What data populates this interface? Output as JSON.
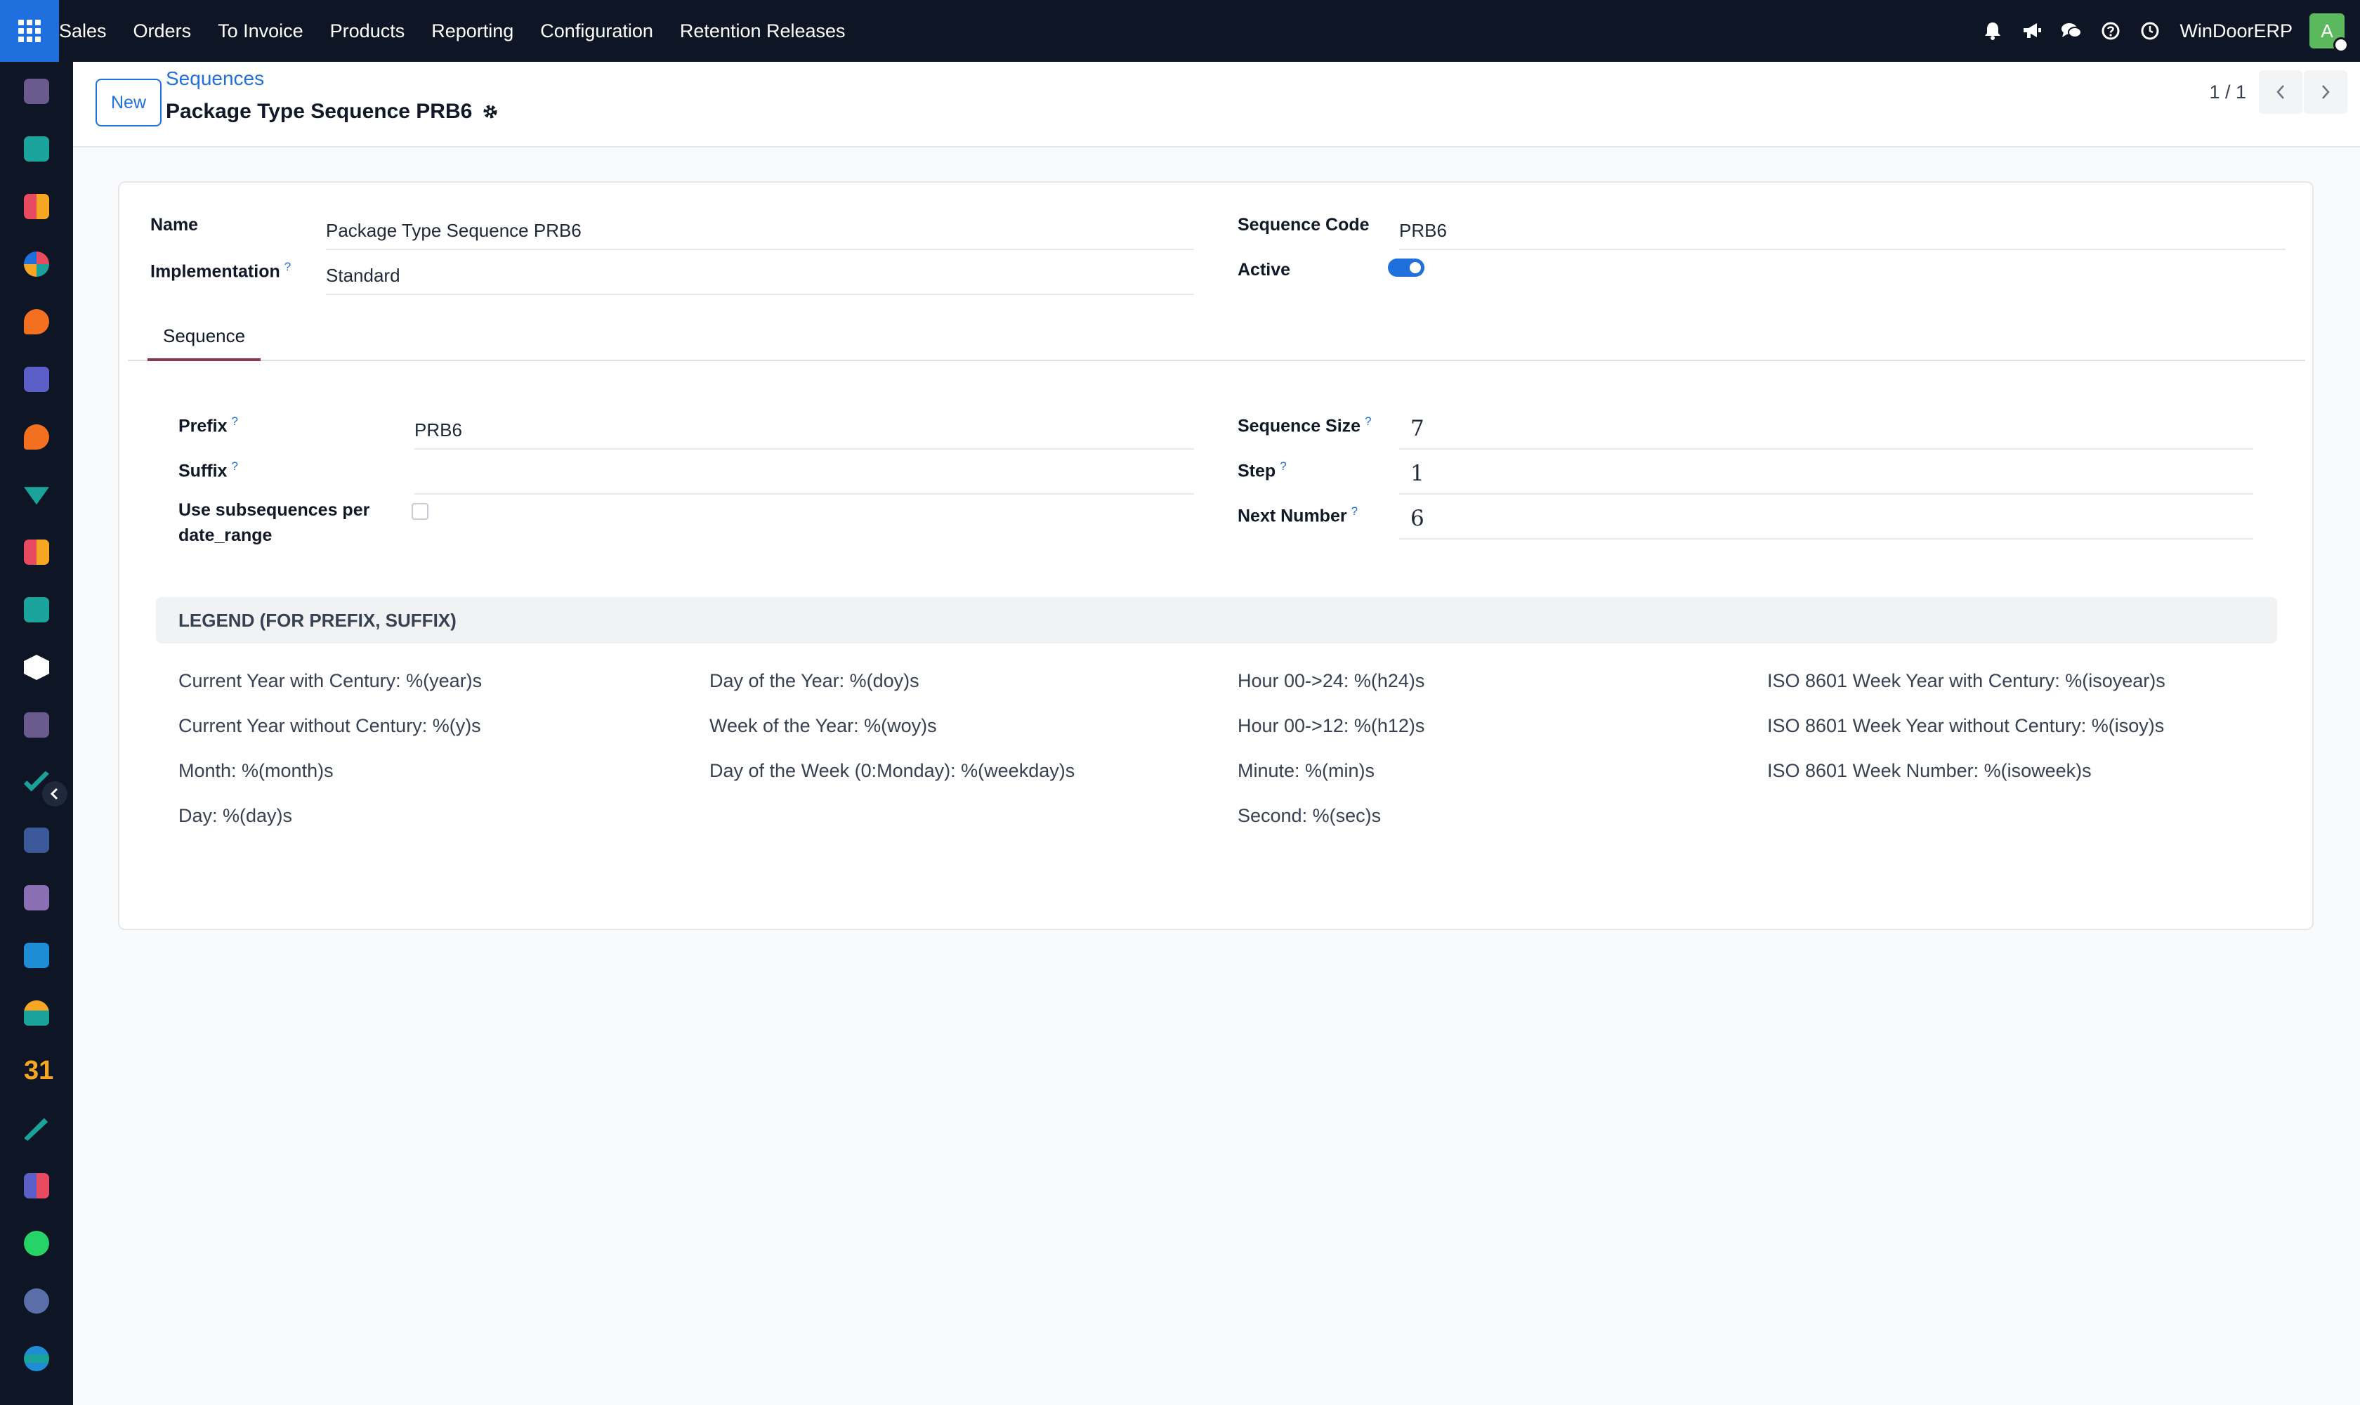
{
  "topbar": {
    "menu": [
      "Sales",
      "Orders",
      "To Invoice",
      "Products",
      "Reporting",
      "Configuration",
      "Retention Releases"
    ],
    "company": "WinDoorERP",
    "avatar_initial": "A",
    "icons": [
      "bell-icon",
      "megaphone-icon",
      "chat-icon",
      "help-icon",
      "clock-icon"
    ]
  },
  "sidebar": {
    "apps": [
      "discuss",
      "contacts",
      "reporting",
      "dashboard",
      "chat",
      "mail",
      "livechat",
      "sign",
      "spreadsheet",
      "employees",
      "inventory",
      "studio",
      "project",
      "knowledge",
      "barcode",
      "invoicing",
      "team",
      "calendar",
      "documents",
      "apps",
      "whatsapp",
      "time-off",
      "website"
    ]
  },
  "control": {
    "new_label": "New",
    "breadcrumb": "Sequences",
    "title": "Package Type Sequence PRB6",
    "pager": "1 / 1"
  },
  "form": {
    "name_label": "Name",
    "name_value": "Package Type Sequence PRB6",
    "implementation_label": "Implementation",
    "implementation_value": "Standard",
    "code_label": "Sequence Code",
    "code_value": "PRB6",
    "active_label": "Active",
    "active": true,
    "help_mark": "?"
  },
  "tabs": [
    "Sequence"
  ],
  "sequence": {
    "prefix_label": "Prefix",
    "prefix_value": "PRB6",
    "suffix_label": "Suffix",
    "suffix_value": "",
    "subseq_label_1": "Use subsequences per",
    "subseq_label_2": "date_range",
    "subseq_checked": false,
    "size_label": "Sequence Size",
    "size_value": "7",
    "step_label": "Step",
    "step_value": "1",
    "next_label": "Next Number",
    "next_value": "6"
  },
  "legend": {
    "title": "LEGEND (FOR PREFIX, SUFFIX)",
    "col1": [
      "Current Year with Century: %(year)s",
      "Current Year without Century: %(y)s",
      "Month: %(month)s",
      "Day: %(day)s"
    ],
    "col2": [
      "Day of the Year: %(doy)s",
      "Week of the Year: %(woy)s",
      "Day of the Week (0:Monday): %(weekday)s"
    ],
    "col3": [
      "Hour 00->24: %(h24)s",
      "Hour 00->12: %(h12)s",
      "Minute: %(min)s",
      "Second: %(sec)s"
    ],
    "col4": [
      "ISO 8601 Week Year with Century: %(isoyear)s",
      "ISO 8601 Week Year without Century: %(isoy)s",
      "ISO 8601 Week Number: %(isoweek)s"
    ]
  },
  "colors": {
    "navbar": "#0e1525",
    "accent": "#1f6fde",
    "tab_underline": "#8a3a4d"
  }
}
